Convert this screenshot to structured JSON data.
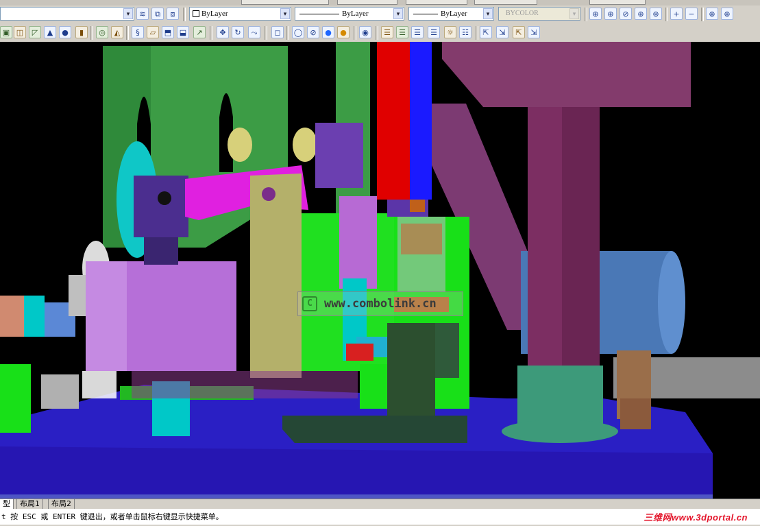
{
  "toolbar": {
    "layer_combo": {
      "value": ""
    },
    "color_combo": {
      "value": "ByLayer"
    },
    "linetype_combo": {
      "value": "ByLayer"
    },
    "lineweight_combo": {
      "value": "ByLayer"
    },
    "plotstyle_combo": {
      "value": "BYCOLOR"
    },
    "arrow_glyph": "▾"
  },
  "icons": {
    "layer_tools": [
      "layer-properties-icon",
      "layer-state-icon",
      "layer-previous-icon"
    ],
    "zoom_tools": [
      "zoom-realtime-icon",
      "zoom-window-icon",
      "zoom-dynamic-icon",
      "zoom-scale-icon",
      "zoom-center-icon",
      "zoom-in-icon",
      "zoom-out-icon",
      "zoom-all-icon",
      "zoom-extents-icon"
    ],
    "modeling_tools": [
      "polysolid-icon",
      "box-icon",
      "wedge-icon",
      "cone-icon",
      "sphere-icon",
      "cylinder-icon",
      "torus-icon",
      "pyramid-icon",
      "helix-icon",
      "planar-surface-icon",
      "extrude-icon",
      "presspull-icon",
      "sweep-icon",
      "revolve-icon",
      "loft-icon"
    ],
    "view_tools": [
      "3d-move-icon",
      "3d-rotate-icon",
      "3d-align-icon"
    ],
    "visual_style_tools": [
      "2d-wireframe-icon",
      "3d-wireframe-icon",
      "3d-hidden-icon",
      "realistic-icon",
      "conceptual-icon",
      "visual-style-manager-icon"
    ],
    "render_tools": [
      "render-icon",
      "lights-icon",
      "materials-icon",
      "mapping-icon",
      "render-env-icon",
      "render-settings-icon",
      "camera-icon",
      "walk-icon",
      "fly-icon",
      "lock-icon"
    ]
  },
  "viewport": {
    "watermark_url": "www.combolink.cn",
    "watermark_logo": "C"
  },
  "tabs": {
    "model": "型",
    "layout1": "布局1",
    "layout2": "布局2"
  },
  "command_line": {
    "text": "t 按 ESC 或 ENTER 键退出，或者单击鼠标右键显示快捷菜单。"
  },
  "watermark": {
    "cn": "三维网",
    "url": "www.3dportal.cn"
  },
  "colors": {
    "background": "#000000",
    "base_plate": "#2a1fc4",
    "frame_green": "#3c9c45",
    "bracket_purple": "#b66fd8",
    "column_maroon": "#7c2e62",
    "rail_red": "#e00000",
    "rail_blue": "#1a1aff",
    "accent_cyan": "#00c8c8",
    "arm_magenta": "#e020e0",
    "plate_khaki": "#b4b06a",
    "bright_green": "#18e018"
  }
}
